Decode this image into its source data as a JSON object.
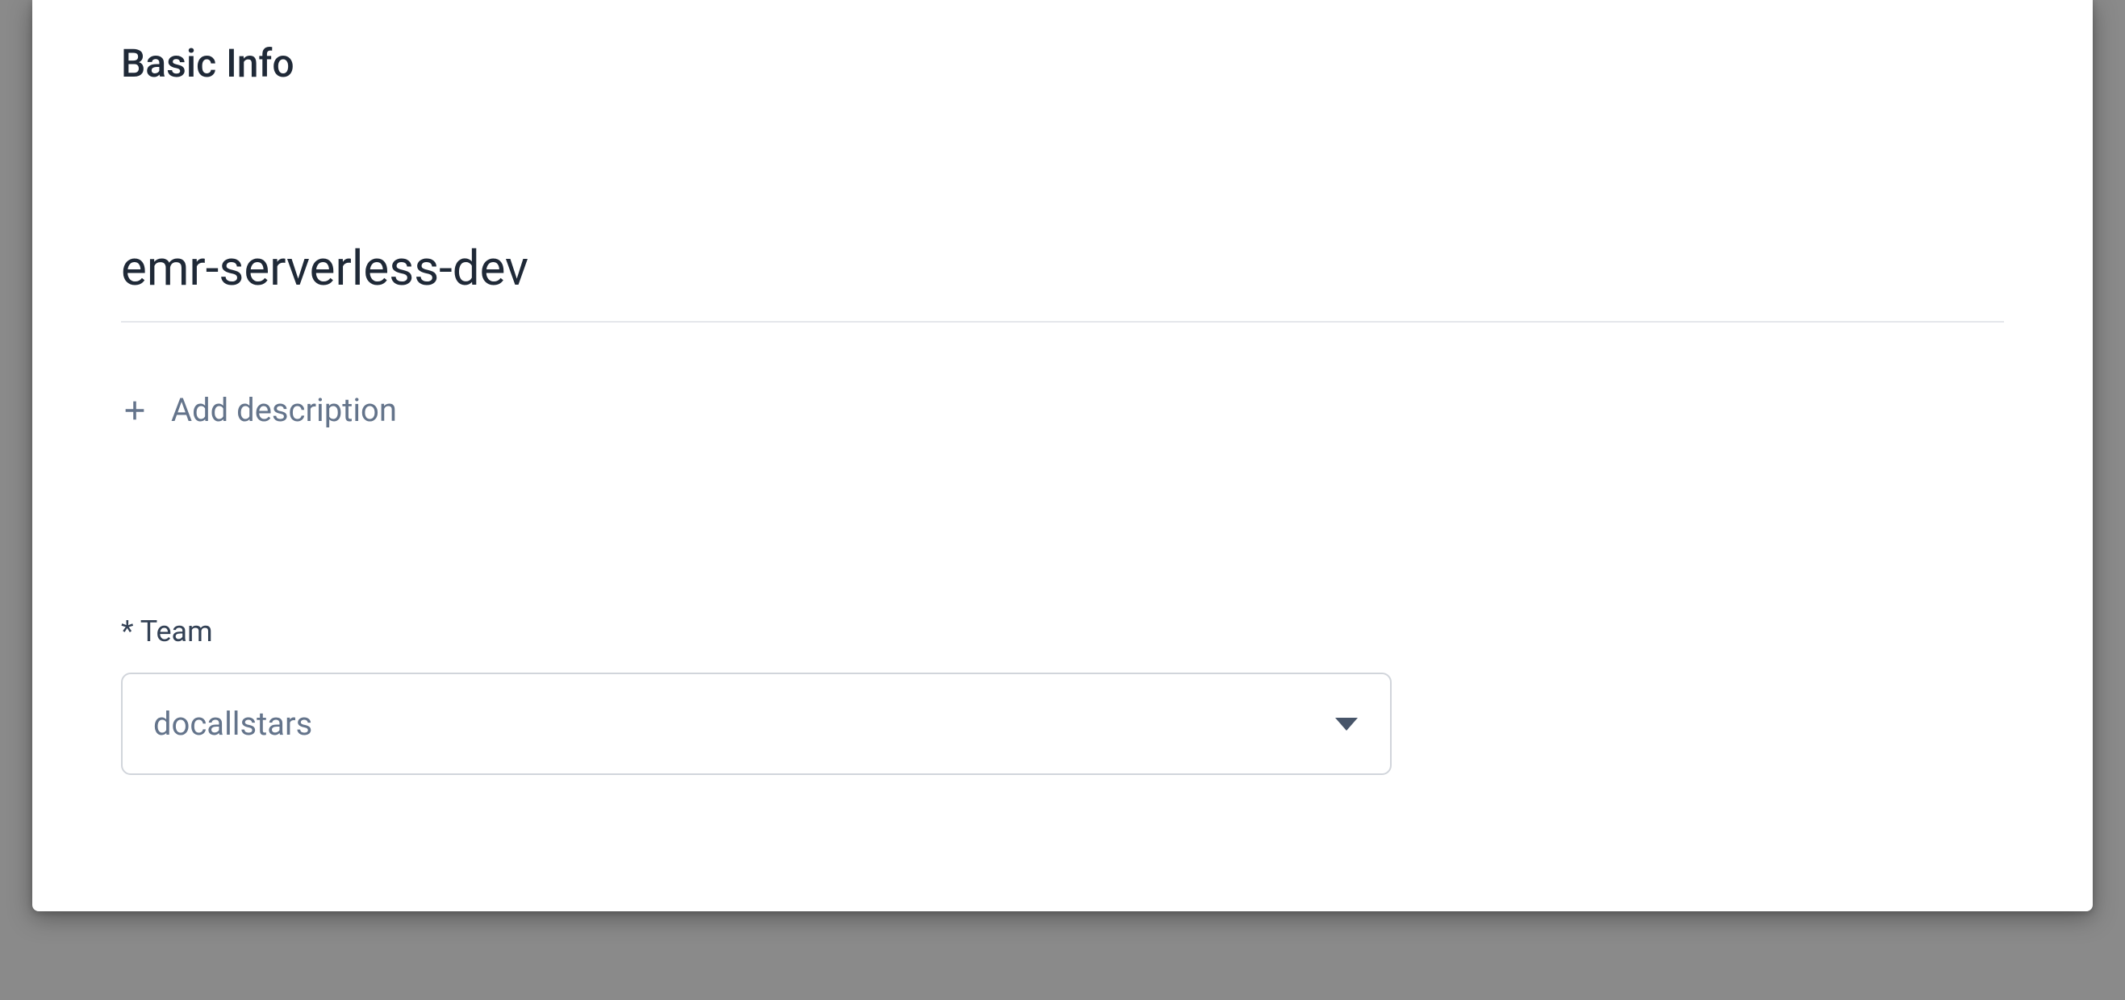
{
  "section": {
    "title": "Basic Info"
  },
  "form": {
    "name_value": "emr-serverless-dev",
    "add_description_label": "Add description",
    "team": {
      "label": "* Team",
      "selected": "docallstars"
    }
  }
}
